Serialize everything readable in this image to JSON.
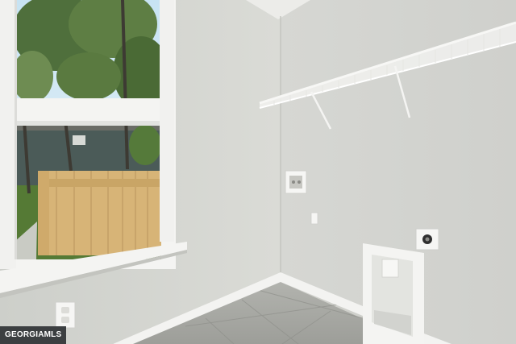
{
  "watermark": {
    "text": "GEORGIAMLS"
  },
  "colors": {
    "left_wall": "#d6d7d2",
    "right_wall": "#d9dad6",
    "ceiling": "#ececea",
    "trim": "#f3f3f1",
    "floor": "#a7a8a3",
    "sky": "#cfe6f2",
    "fence": "#d9b77a",
    "foliage": "#4f6f3c",
    "house": "#4a5a58"
  },
  "icons": [
    "window",
    "wire-shelf",
    "washer-box",
    "dryer-outlet",
    "wall-outlet",
    "light-switch",
    "dryer-vent"
  ]
}
